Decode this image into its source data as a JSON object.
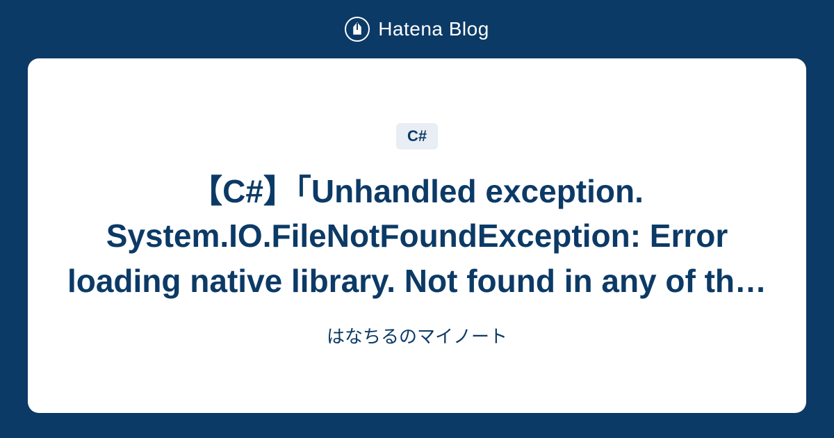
{
  "header": {
    "logo_text": "Hatena Blog"
  },
  "card": {
    "tag": "C#",
    "title": "【C#】「Unhandled exception. System.IO.FileNotFoundException: Error loading native library. Not found in any of th…",
    "subtitle": "はなちるのマイノート"
  }
}
